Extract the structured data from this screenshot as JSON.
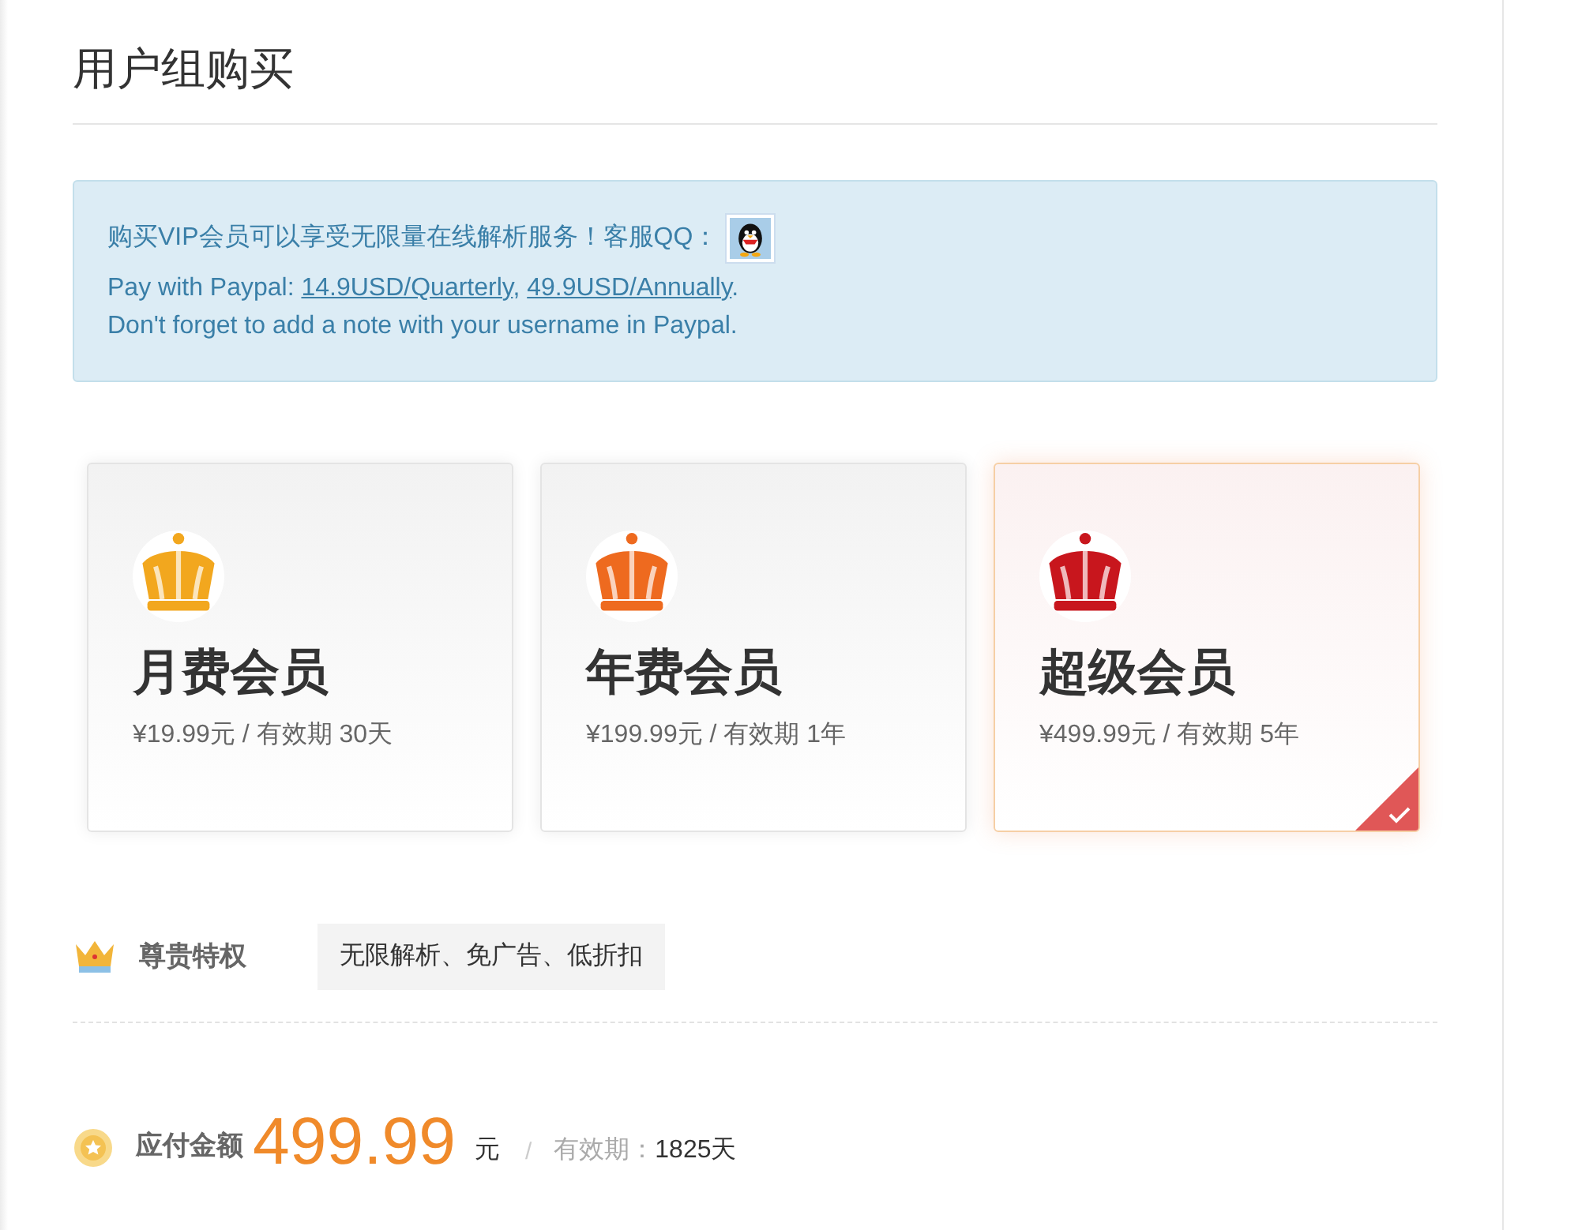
{
  "title": "用户组购买",
  "notice": {
    "line1": "购买VIP会员可以享受无限量在线解析服务！客服QQ：",
    "line2": {
      "prefix": "Pay with Paypal:",
      "links": [
        {
          "text": "14.9USD/Quarterly",
          "punctuation": ","
        },
        {
          "text": "49.9USD/Annually",
          "punctuation": "."
        }
      ]
    },
    "line3": "Don't forget to add a note with your username in Paypal."
  },
  "plans": [
    {
      "name": "月费会员",
      "price": "¥19.99元 / 有效期 30天",
      "color": "#f2a71e",
      "selected": false
    },
    {
      "name": "年费会员",
      "price": "¥199.99元 / 有效期 1年",
      "color": "#ee6a1f",
      "selected": false
    },
    {
      "name": "超级会员",
      "price": "¥499.99元 / 有效期 5年",
      "color": "#c8161d",
      "selected": true
    }
  ],
  "privilege": {
    "label": "尊贵特权",
    "value": "无限解析、免广告、低折扣"
  },
  "payment": {
    "label": "应付金额",
    "amount": "499.99",
    "unit": "元",
    "separator": "/",
    "validity_label": "有效期：",
    "validity": "1825天"
  }
}
